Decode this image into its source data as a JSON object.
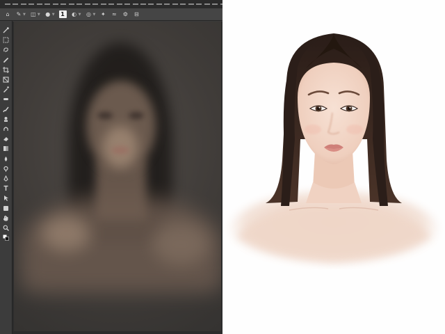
{
  "menubar": {
    "items": [
      "menu-1",
      "menu-2",
      "menu-3",
      "menu-4",
      "menu-5",
      "menu-6",
      "menu-7",
      "menu-8",
      "menu-9",
      "menu-10",
      "menu-11",
      "menu-12",
      "menu-13",
      "menu-14",
      "menu-15",
      "menu-16",
      "menu-17",
      "menu-18",
      "menu-19",
      "menu-20",
      "menu-21",
      "menu-22",
      "menu-23",
      "menu-24",
      "menu-25",
      "menu-26",
      "menu-27",
      "menu-28"
    ]
  },
  "options_bar": {
    "brush_size": "1",
    "icons": [
      "home-icon",
      "brush-preset-icon",
      "mode-icon",
      "brush-dot-icon",
      "opacity-icon",
      "flow-icon",
      "airbrush-icon",
      "smoothing-icon",
      "settings-gear-icon",
      "symmetry-icon",
      "pressure-icon"
    ]
  },
  "toolbox": {
    "tools": [
      "move-tool-icon",
      "marquee-tool-icon",
      "lasso-tool-icon",
      "quick-select-tool-icon",
      "crop-tool-icon",
      "frame-tool-icon",
      "eyedropper-tool-icon",
      "healing-brush-tool-icon",
      "brush-tool-icon",
      "clone-stamp-tool-icon",
      "history-brush-tool-icon",
      "eraser-tool-icon",
      "gradient-tool-icon",
      "blur-tool-icon",
      "dodge-tool-icon",
      "pen-tool-icon",
      "type-tool-icon",
      "path-select-tool-icon",
      "shape-tool-icon",
      "hand-tool-icon",
      "zoom-tool-icon",
      "color-swatches-icon"
    ]
  },
  "colors": {
    "app_chrome": "#3a3a3a",
    "menubar": "#2b2b2b",
    "options_bar": "#454545",
    "toolbox": "#3c3c3c",
    "canvas_bg": "#2c2c2c",
    "result_bg": "#fefefe"
  }
}
